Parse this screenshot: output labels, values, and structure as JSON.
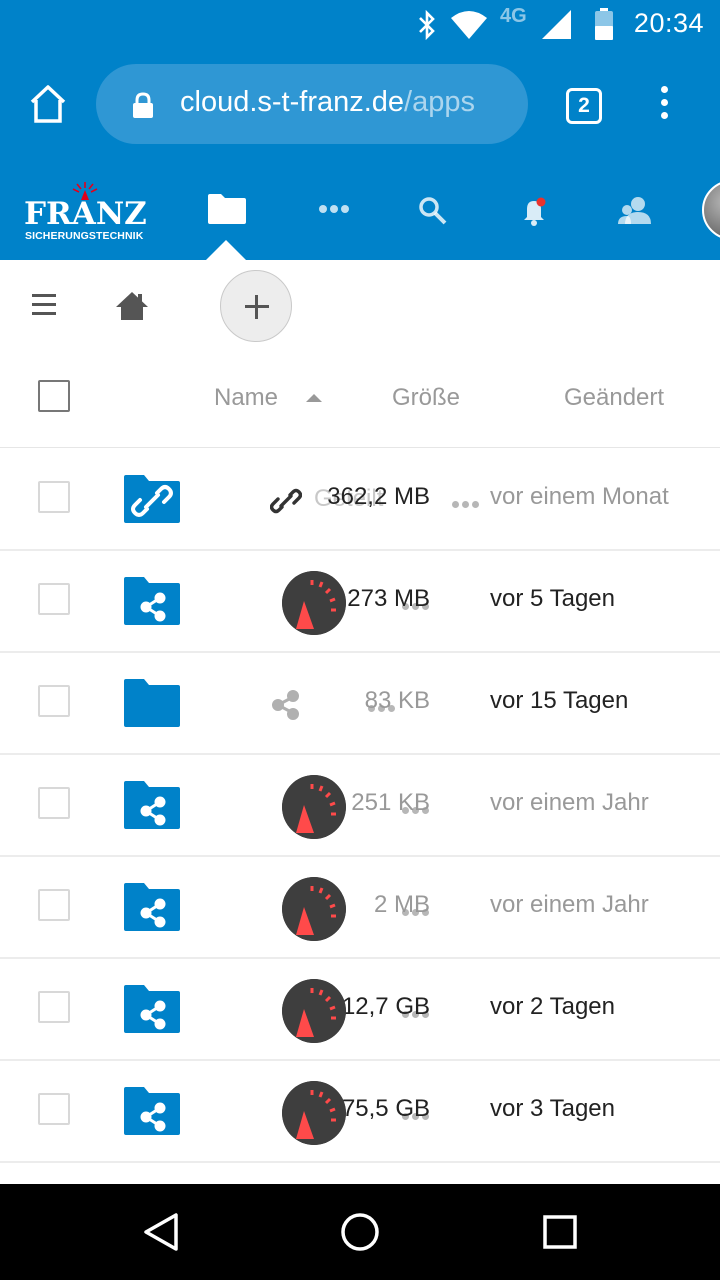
{
  "status_bar": {
    "time": "20:34",
    "network": "4G",
    "battery_level": "50",
    "icons": [
      "bluetooth-icon",
      "wifi-icon",
      "cell-signal-icon",
      "battery-icon"
    ]
  },
  "browser": {
    "url_host": "cloud.s-t-franz.de",
    "url_path": "/apps",
    "tab_count": "2"
  },
  "app_header": {
    "logo_text": "FRANZ",
    "logo_subtitle": "SICHERUNGSTECHNIK",
    "nav_icons": [
      "files-icon",
      "more-apps-icon",
      "search-icon",
      "notifications-icon",
      "contacts-icon",
      "avatar"
    ],
    "colors": {
      "primary": "#0082c9",
      "folder": "#0082c9",
      "avatar_dial": "#ff4a4a"
    }
  },
  "table": {
    "columns": {
      "name": "Name",
      "size": "Größe",
      "modified": "Geändert"
    },
    "rows": [
      {
        "size": "362,2 MB",
        "modified": "vor einem Monat",
        "ghost": "Geteilt",
        "icon": "link-folder-icon",
        "share": "link"
      },
      {
        "size": "273 MB",
        "modified": "vor 5 Tagen",
        "icon": "shared-folder-icon",
        "share": "owner-avatar"
      },
      {
        "size": "83 KB",
        "modified": "vor 15 Tagen",
        "icon": "folder-icon",
        "share": "share"
      },
      {
        "size": "251 KB",
        "modified": "vor einem Jahr",
        "icon": "shared-folder-icon",
        "share": "owner-avatar"
      },
      {
        "size": "2 MB",
        "modified": "vor einem Jahr",
        "icon": "shared-folder-icon",
        "share": "owner-avatar"
      },
      {
        "size": "12,7 GB",
        "modified": "vor 2 Tagen",
        "icon": "shared-folder-icon",
        "share": "owner-avatar"
      },
      {
        "size": "75,5 GB",
        "modified": "vor 3 Tagen",
        "icon": "shared-folder-icon",
        "share": "owner-avatar"
      }
    ]
  }
}
